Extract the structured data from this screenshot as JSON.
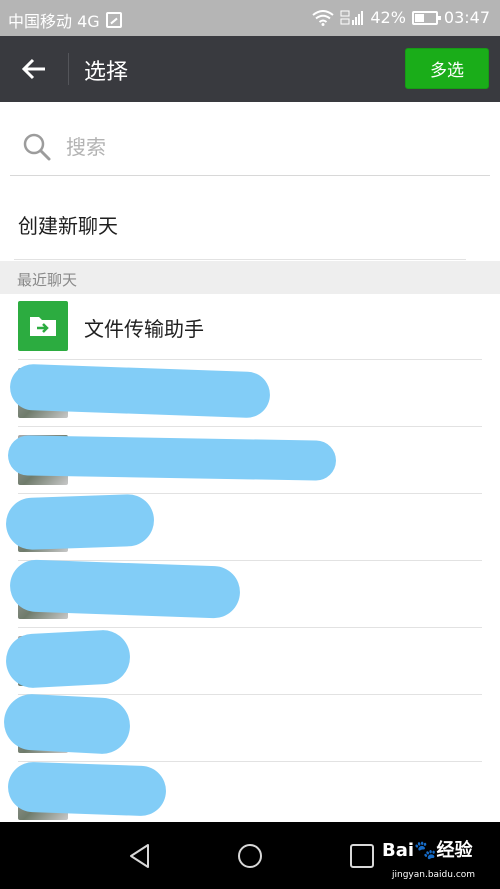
{
  "status_bar": {
    "carrier": "中国移动 4G",
    "battery": "42%",
    "time": "03:47",
    "network_label": "4G"
  },
  "toolbar": {
    "title": "选择",
    "multi_select_label": "多选",
    "back_icon": "arrow-left-icon"
  },
  "search": {
    "placeholder": "搜索",
    "icon": "search-icon"
  },
  "create_chat": {
    "label": "创建新聊天"
  },
  "recent": {
    "header": "最近聊天",
    "items": [
      {
        "name": "文件传输助手",
        "icon": "folder-arrow-icon"
      }
    ]
  },
  "colors": {
    "toolbar_bg": "#393a3f",
    "accent_green": "#1aad19",
    "status_bar_bg": "#b5b5b5",
    "section_bg": "#eeeeee",
    "redaction": "#82cdf7"
  }
}
